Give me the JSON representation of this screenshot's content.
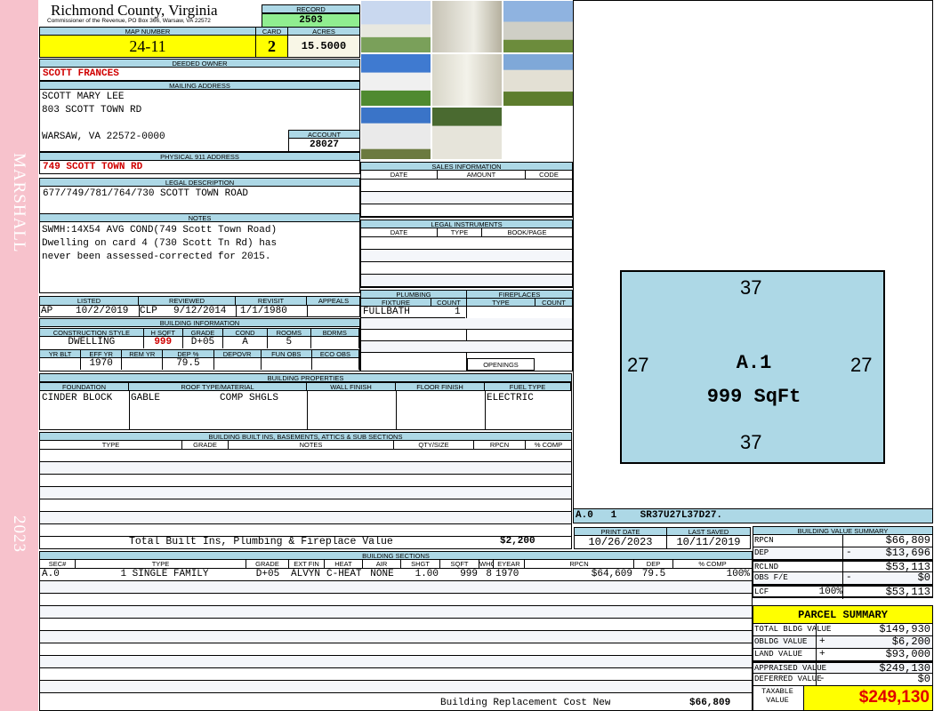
{
  "side": {
    "top": "MARSHALL",
    "bottom": "2023"
  },
  "header": {
    "title": "Richmond County, Virginia",
    "subtitle": "Commissioner of the Revenue, PO Box 366, Warsaw, VA 22572",
    "record_label": "RECORD",
    "record": "2503"
  },
  "parcel": {
    "map_label": "MAP NUMBER",
    "map": "24-11",
    "card_label": "CARD",
    "card": "2",
    "acres_label": "ACRES",
    "acres": "15.5000"
  },
  "owner": {
    "label": "DEEDED OWNER",
    "value": "SCOTT FRANCES"
  },
  "mailing": {
    "label": "MAILING ADDRESS",
    "line1": "SCOTT MARY LEE",
    "line2": "803 SCOTT TOWN RD",
    "line3": "WARSAW, VA 22572-0000",
    "account_label": "ACCOUNT",
    "account": "28027"
  },
  "physical": {
    "label": "PHYSICAL 911 ADDRESS",
    "value": "749 SCOTT TOWN RD"
  },
  "legal": {
    "label": "LEGAL DESCRIPTION",
    "value": "677/749/781/764/730 SCOTT TOWN ROAD"
  },
  "notes": {
    "label": "NOTES",
    "lines": [
      "SWMH:14X54 AVG COND(749 Scott Town Road)",
      "Dwelling on card 4 (730 Scott Tn Rd) has",
      "never been assessed-corrected for 2015."
    ]
  },
  "status": {
    "labels": [
      "LISTED",
      "REVIEWED",
      "REVISIT",
      "APPEALS"
    ],
    "listed_by": "AP",
    "listed": "10/2/2019",
    "reviewed_by": "CLP",
    "reviewed": "9/12/2014",
    "revisit": "1/1/1980",
    "appeals": ""
  },
  "building_info": {
    "label": "BUILDING INFORMATION",
    "h1": [
      "CONSTRUCTION STYLE",
      "H SQFT",
      "GRADE",
      "COND",
      "ROOMS",
      "BDRMS"
    ],
    "v1": [
      "DWELLING",
      "999",
      "D+05",
      "A",
      "5",
      ""
    ],
    "h2": [
      "YR BLT",
      "EFF YR",
      "REM YR",
      "DEP %",
      "DEPOVR",
      "FUN OBS",
      "ECO OBS"
    ],
    "v2": [
      "",
      "1970",
      "",
      "79.5",
      "",
      "",
      ""
    ]
  },
  "sales": {
    "label": "SALES INFORMATION",
    "cols": [
      "DATE",
      "AMOUNT",
      "CODE"
    ]
  },
  "instruments": {
    "label": "LEGAL INSTRUMENTS",
    "cols": [
      "DATE",
      "TYPE",
      "BOOK/PAGE"
    ]
  },
  "plumbing": {
    "label": "PLUMBING",
    "cols": [
      "FIXTURE",
      "COUNT"
    ],
    "rows": [
      [
        "FULLBATH",
        "1"
      ]
    ]
  },
  "fireplaces": {
    "label": "FIREPLACES",
    "cols": [
      "TYPE",
      "COUNT"
    ],
    "openings": "OPENINGS"
  },
  "properties": {
    "label": "BUILDING PROPERTIES",
    "cols": [
      "FOUNDATION",
      "ROOF TYPE/MATERIAL",
      "WALL FINISH",
      "FLOOR FINISH",
      "FUEL TYPE"
    ],
    "foundation": "CINDER BLOCK",
    "roof_type": "GABLE",
    "roof_material": "COMP SHGLS",
    "wall": "",
    "floor": "",
    "fuel": "ELECTRIC"
  },
  "builtins": {
    "label": "BUILDING BUILT INS, BASEMENTS, ATTICS & SUB SECTIONS",
    "cols": [
      "TYPE",
      "GRADE",
      "NOTES",
      "QTY/SIZE",
      "RPCN",
      "% COMP"
    ],
    "total_label": "Total Built Ins, Plumbing & Fireplace Value",
    "total": "$2,200"
  },
  "sketch": {
    "top": "37",
    "bottom": "37",
    "left": "27",
    "right": "27",
    "label": "A.1",
    "area": "999 SqFt",
    "code": "A.0   1    SR37U27L37D27."
  },
  "dates": {
    "print_label": "PRINT DATE",
    "print": "10/26/2023",
    "saved_label": "LAST SAVED",
    "saved": "10/11/2019"
  },
  "sections": {
    "label": "BUILDING SECTIONS",
    "cols": [
      "SEC#",
      "TYPE",
      "GRADE",
      "EXT FIN",
      "HEAT",
      "AIR",
      "SHGT",
      "SQFT",
      "WHGT",
      "EYEAR",
      "RPCN",
      "DEP",
      "% COMP"
    ],
    "rows": [
      [
        "A.0",
        "1 SINGLE FAMILY",
        "D+05",
        "ALVYN",
        "C-HEAT",
        "NONE",
        "1.00",
        "999",
        "8",
        "1970",
        "$64,609",
        "79.5",
        "100%"
      ]
    ],
    "total_label": "Building Replacement Cost New",
    "total": "$66,809"
  },
  "value_summary": {
    "label": "BUILDING VALUE SUMMARY",
    "rows": [
      {
        "k": "RPCN",
        "op": "",
        "v": "$66,809"
      },
      {
        "k": "DEP",
        "op": "-",
        "v": "$13,696"
      },
      {
        "k": "RCLND",
        "op": "",
        "v": "$53,113"
      },
      {
        "k": "OBS F/E",
        "op": "-",
        "v": "$0"
      },
      {
        "k": "LCF",
        "pct": "100%",
        "op": "",
        "v": "$53,113"
      }
    ]
  },
  "parcel_summary": {
    "label": "PARCEL SUMMARY",
    "rows": [
      {
        "k": "TOTAL BLDG VALUE",
        "op": "",
        "v": "$149,930"
      },
      {
        "k": "OBLDG VALUE",
        "op": "+",
        "v": "$6,200"
      },
      {
        "k": "LAND VALUE",
        "op": "+",
        "v": "$93,000"
      },
      {
        "k": "APPRAISED VALUE",
        "op": "",
        "v": "$249,130"
      },
      {
        "k": "DEFERRED VALUE",
        "op": "-",
        "v": "$0"
      }
    ],
    "taxable_label": "TAXABLE VALUE",
    "taxable": "$249,130"
  }
}
